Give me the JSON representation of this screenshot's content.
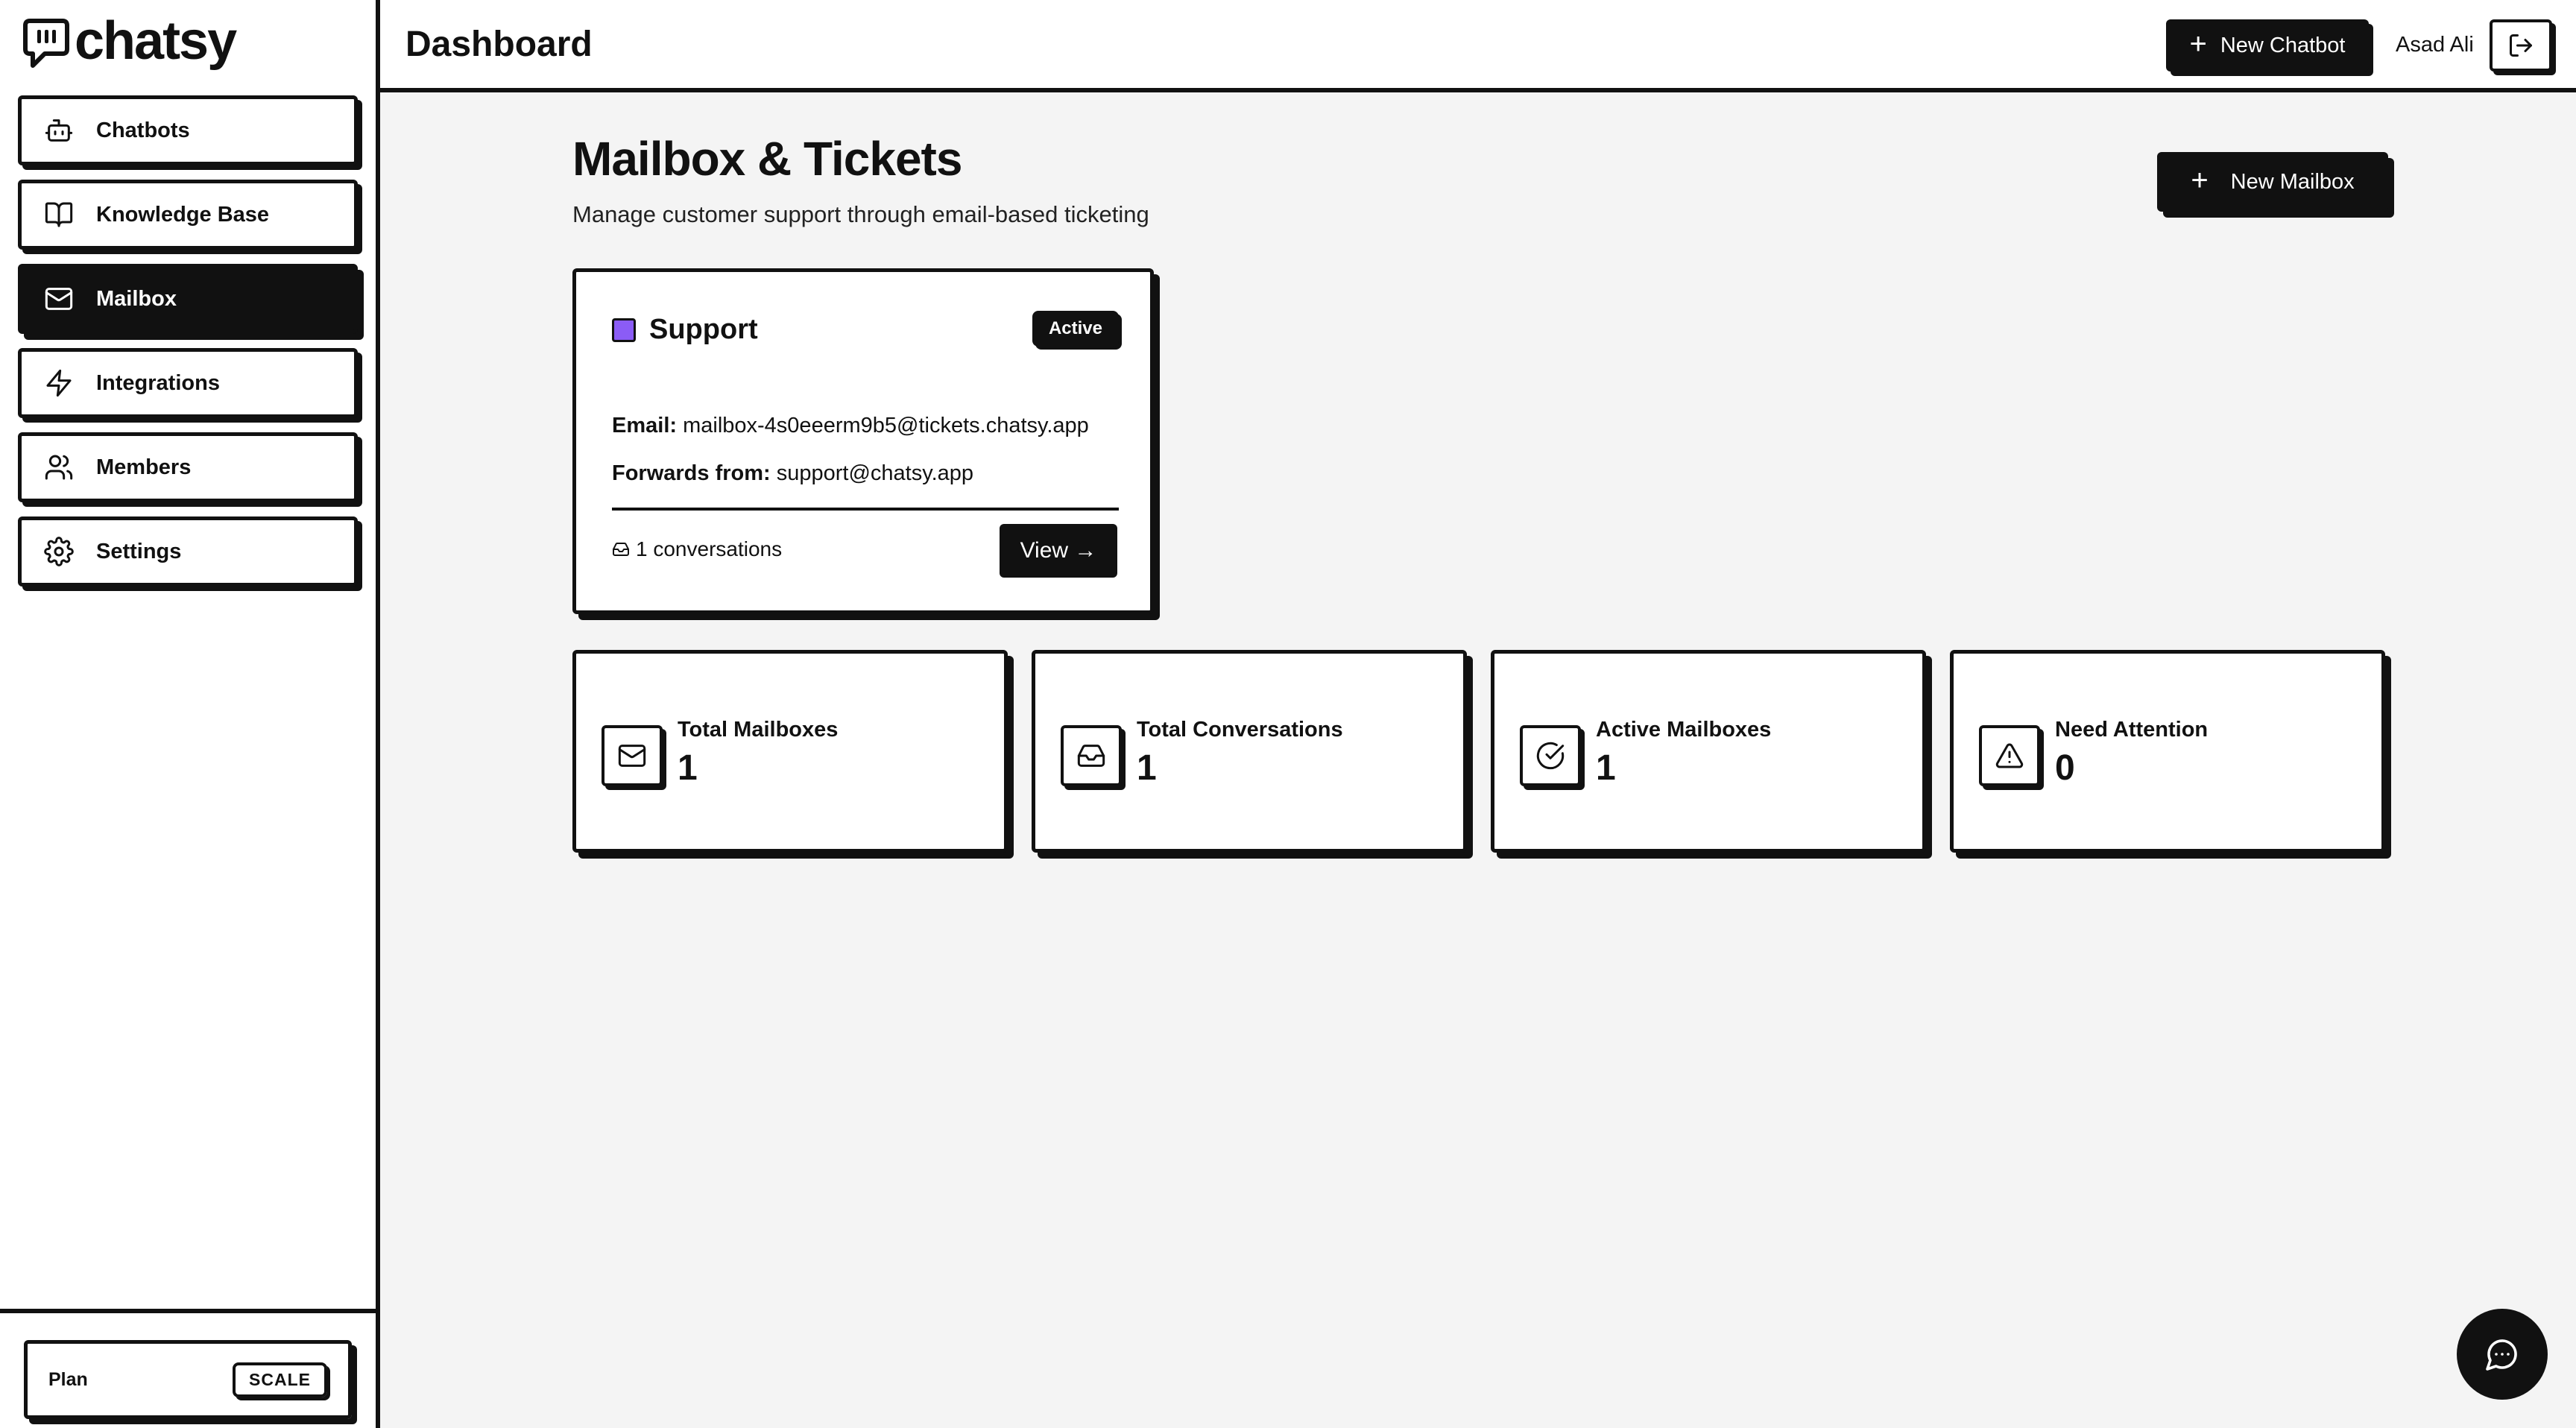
{
  "brand": {
    "name": "chatsy",
    "logo_icon": "chat-bubble-icon"
  },
  "header": {
    "title": "Dashboard",
    "new_chatbot_label": "New Chatbot",
    "user_name": "Asad Ali",
    "logout_icon": "logout-icon"
  },
  "sidebar": {
    "items": [
      {
        "label": "Chatbots",
        "icon": "bot-icon",
        "active": false
      },
      {
        "label": "Knowledge Base",
        "icon": "book-icon",
        "active": false
      },
      {
        "label": "Mailbox",
        "icon": "mail-icon",
        "active": true
      },
      {
        "label": "Integrations",
        "icon": "lightning-icon",
        "active": false
      },
      {
        "label": "Members",
        "icon": "users-icon",
        "active": false
      },
      {
        "label": "Settings",
        "icon": "gear-icon",
        "active": false
      }
    ],
    "plan": {
      "label": "Plan",
      "value": "SCALE"
    }
  },
  "main": {
    "title": "Mailbox & Tickets",
    "subtitle": "Manage customer support through email-based ticketing",
    "new_mailbox_label": "New Mailbox"
  },
  "mailbox_card": {
    "name": "Support",
    "color": "#8b5cf6",
    "status": "Active",
    "email_label": "Email:",
    "email_value": "mailbox-4s0eeerm9b5@tickets.chatsy.app",
    "forwards_label": "Forwards from:",
    "forwards_value": "support@chatsy.app",
    "conversations": "1 conversations",
    "view_label": "View →"
  },
  "stats": [
    {
      "label": "Total Mailboxes",
      "value": "1",
      "icon": "mail-icon"
    },
    {
      "label": "Total Conversations",
      "value": "1",
      "icon": "inbox-icon"
    },
    {
      "label": "Active Mailboxes",
      "value": "1",
      "icon": "check-circle-icon"
    },
    {
      "label": "Need Attention",
      "value": "0",
      "icon": "warning-icon"
    }
  ],
  "colors": {
    "accent": "#111111",
    "background": "#f4f4f4",
    "mailbox_swatch": "#8b5cf6"
  }
}
